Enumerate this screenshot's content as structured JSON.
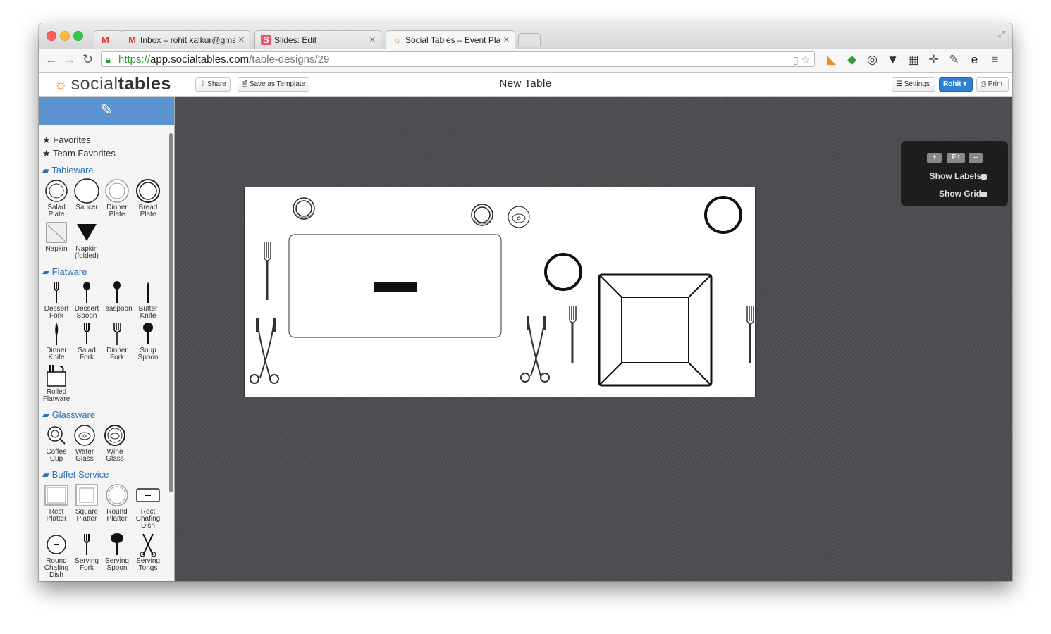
{
  "browser": {
    "tabs": [
      {
        "favicon": "gmail-icon",
        "title": ""
      },
      {
        "favicon": "gmail-icon",
        "title": "Inbox – rohit.kalkur@gmai"
      },
      {
        "favicon": "slides-icon",
        "title": "Slides: Edit"
      },
      {
        "favicon": "socialtables-icon",
        "title": "Social Tables – Event Plann"
      }
    ],
    "url": {
      "scheme": "https://",
      "host": "app.socialtables.com",
      "path": "/table-designs/29"
    }
  },
  "app": {
    "logo": {
      "prefix": "social",
      "suffix": "tables"
    },
    "share_label": "Share",
    "save_template_label": "Save as Template",
    "page_title": "New Table",
    "settings_label": "Settings",
    "user_label": "Rohit",
    "print_label": "Print"
  },
  "sidebar": {
    "favorites": "Favorites",
    "team_favorites": "Team Favorites",
    "categories": [
      {
        "name": "Tableware",
        "items": [
          [
            "Salad",
            "Plate"
          ],
          [
            "Saucer",
            ""
          ],
          [
            "Dinner",
            "Plate"
          ],
          [
            "Bread",
            "Plate"
          ],
          [
            "Napkin",
            ""
          ],
          [
            "Napkin",
            "(folded)"
          ]
        ]
      },
      {
        "name": "Flatware",
        "items": [
          [
            "Dessert",
            "Fork"
          ],
          [
            "Dessert",
            "Spoon"
          ],
          [
            "Teaspoon",
            ""
          ],
          [
            "Butter",
            "Knife"
          ],
          [
            "Dinner",
            "Knife"
          ],
          [
            "Salad",
            "Fork"
          ],
          [
            "Dinner",
            "Fork"
          ],
          [
            "Soup",
            "Spoon"
          ],
          [
            "Rolled",
            "Flatware"
          ]
        ]
      },
      {
        "name": "Glassware",
        "items": [
          [
            "Coffee",
            "Cup"
          ],
          [
            "Water",
            "Glass"
          ],
          [
            "Wine",
            "Glass"
          ]
        ]
      },
      {
        "name": "Buffet Service",
        "items": [
          [
            "Rect",
            "Platter"
          ],
          [
            "Square",
            "Platter"
          ],
          [
            "Round",
            "Platter"
          ],
          [
            "Rect",
            "Chafing Dish"
          ],
          [
            "Round",
            "Chafing Dish"
          ],
          [
            "Serving",
            "Fork"
          ],
          [
            "Serving",
            "Spoon"
          ],
          [
            "Serving",
            "Tongs"
          ]
        ]
      }
    ]
  },
  "zoom": {
    "plus": "+",
    "fit": "Fit",
    "minus": "–",
    "show_labels": "Show Labels:",
    "show_grid": "Show Grid:"
  }
}
